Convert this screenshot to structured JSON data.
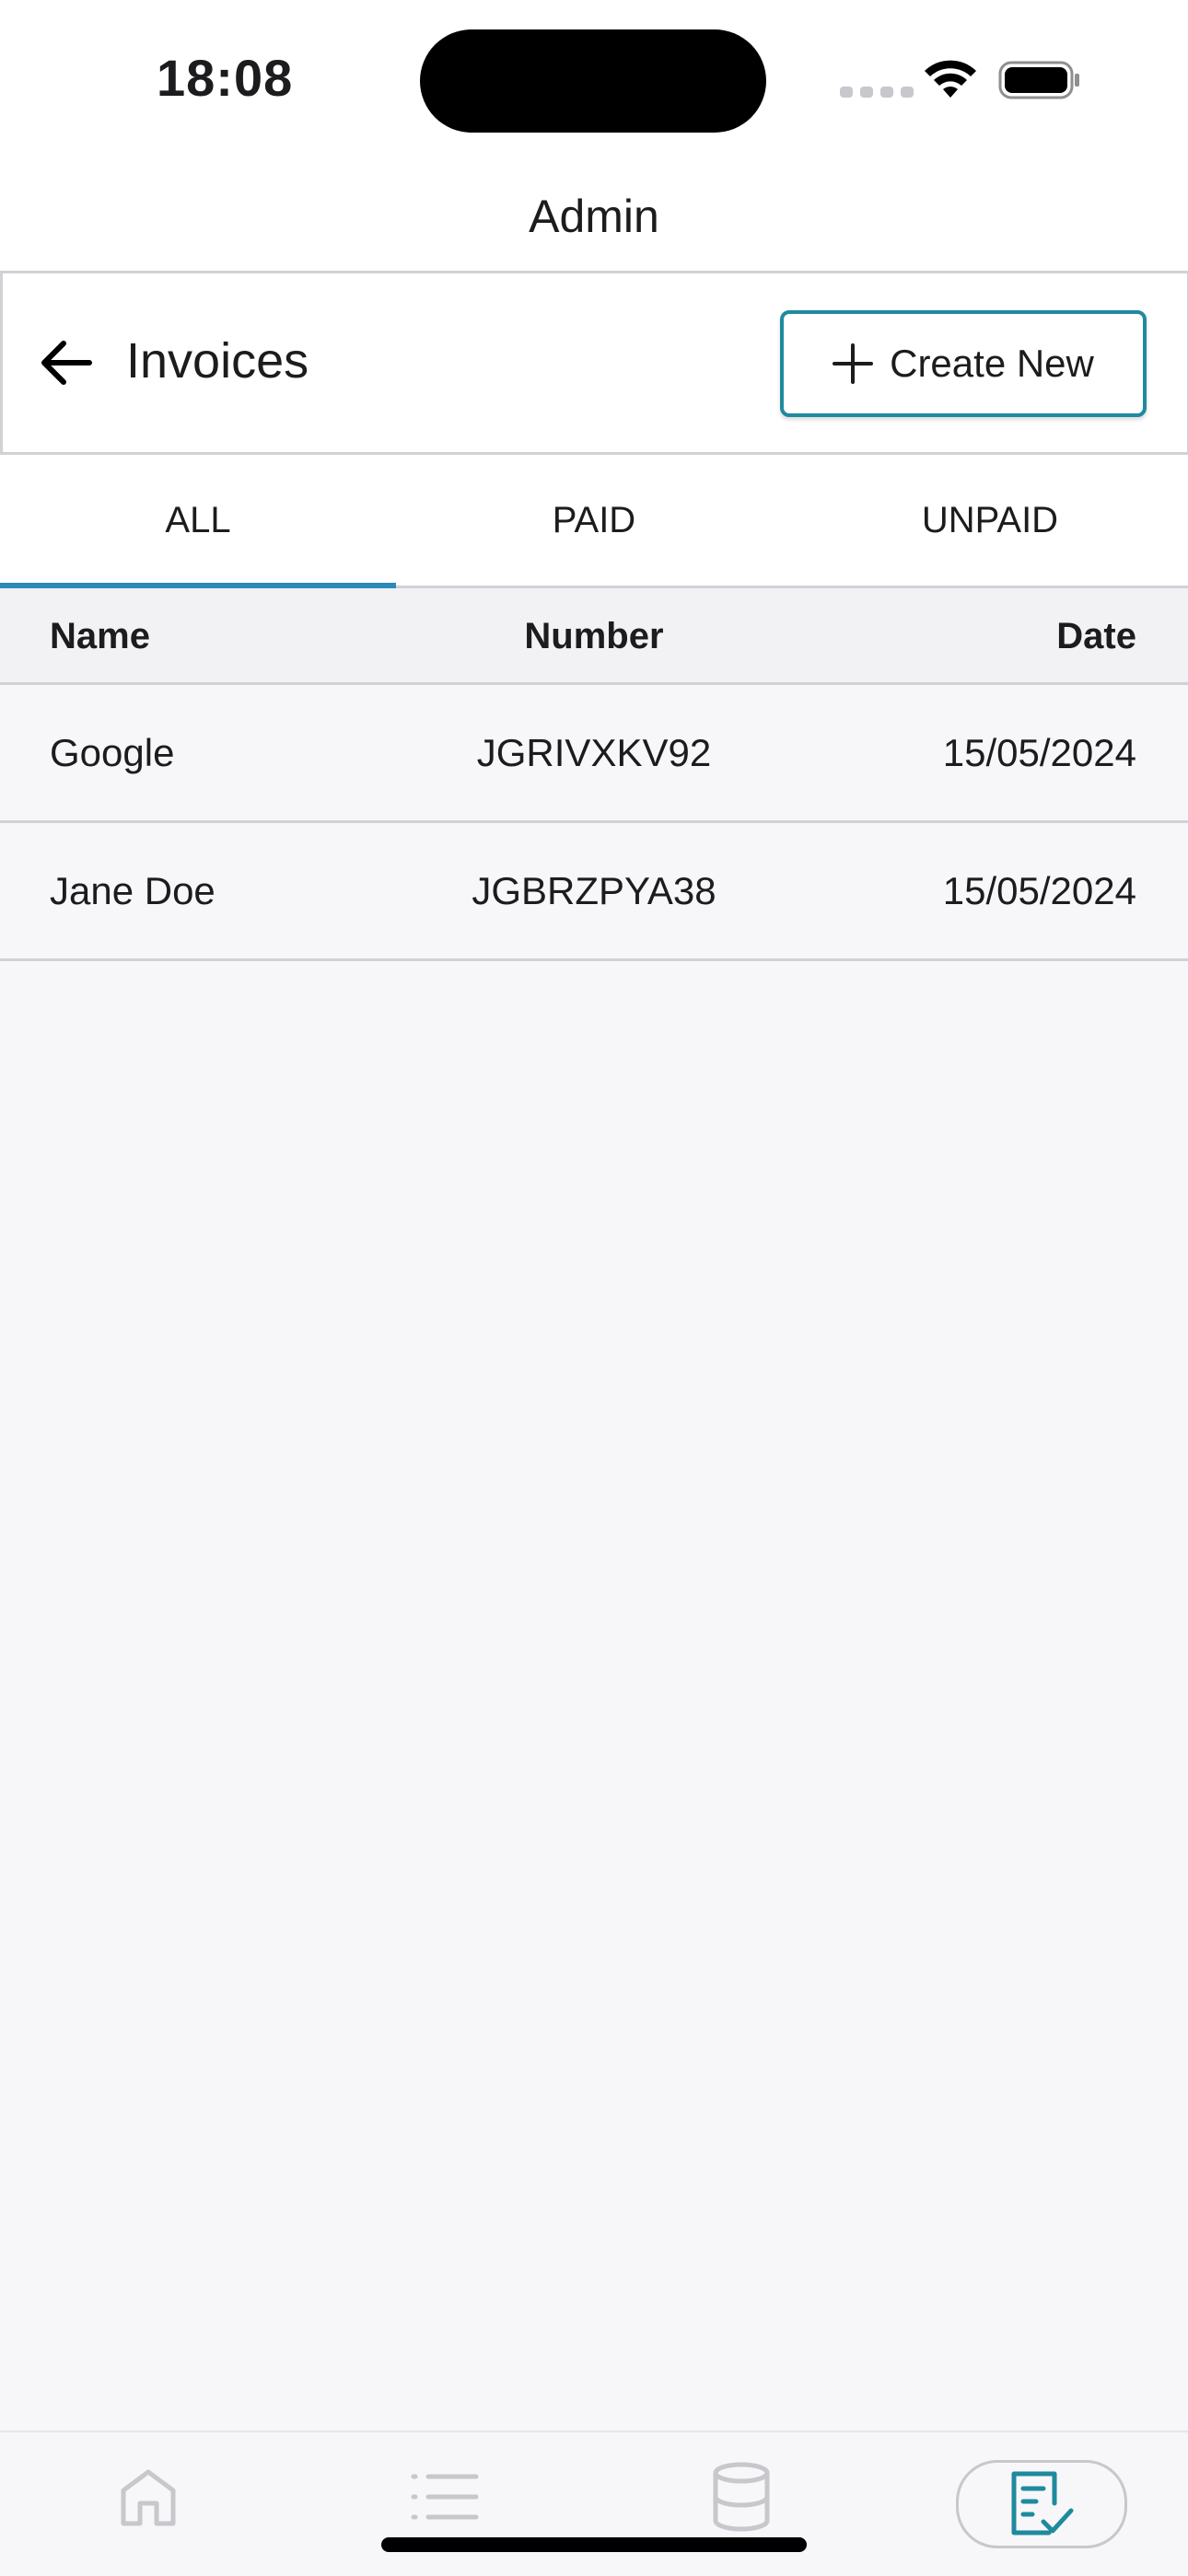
{
  "status": {
    "time": "18:08"
  },
  "app": {
    "title": "Admin"
  },
  "header": {
    "title": "Invoices",
    "create_label": "Create New"
  },
  "tabs": [
    {
      "label": "ALL",
      "active": true
    },
    {
      "label": "PAID",
      "active": false
    },
    {
      "label": "UNPAID",
      "active": false
    }
  ],
  "table": {
    "columns": [
      "Name",
      "Number",
      "Date"
    ],
    "rows": [
      {
        "name": "Google",
        "number": "JGRIVXKV92",
        "date": "15/05/2024"
      },
      {
        "name": "Jane Doe",
        "number": "JGBRZPYA38",
        "date": "15/05/2024"
      }
    ]
  },
  "bottom_nav": [
    {
      "icon": "home-icon",
      "active": false
    },
    {
      "icon": "list-icon",
      "active": false
    },
    {
      "icon": "database-icon",
      "active": false
    },
    {
      "icon": "invoice-check-icon",
      "active": true
    }
  ],
  "colors": {
    "accent": "#1f8a9e",
    "tab_indicator": "#2c8ab8",
    "inactive_icon": "#c7c7cc"
  }
}
